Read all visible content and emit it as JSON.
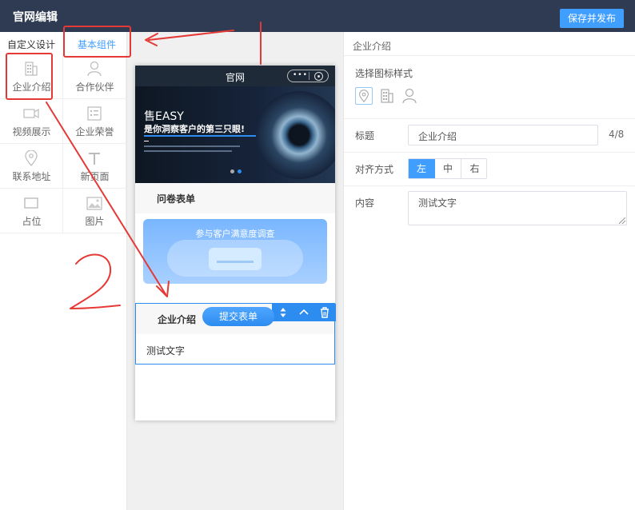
{
  "header": {
    "title": "官网编辑",
    "publish_label": "保存并发布"
  },
  "sidebar": {
    "tabs": [
      {
        "label": "自定义设计"
      },
      {
        "label": "基本组件"
      }
    ],
    "components": [
      {
        "label": "企业介绍",
        "icon": "building-icon"
      },
      {
        "label": "合作伙伴",
        "icon": "user-icon"
      },
      {
        "label": "视频展示",
        "icon": "video-icon"
      },
      {
        "label": "企业荣誉",
        "icon": "list-icon"
      },
      {
        "label": "联系地址",
        "icon": "map-pin-icon"
      },
      {
        "label": "新页面",
        "icon": "text-icon"
      },
      {
        "label": "占位",
        "icon": "placeholder-icon"
      },
      {
        "label": "图片",
        "icon": "image-icon"
      }
    ]
  },
  "preview": {
    "app_title": "官网",
    "capsule_dots": "•••",
    "banner_line1": "售EASY",
    "banner_line2": "是你洞察客户的第三只眼!",
    "survey_section_title": "问卷表单",
    "survey_card_title": "参与客户满意度调查",
    "survey_submit": "提交表单",
    "selected_section_title": "企业介绍",
    "selected_section_text": "测试文字"
  },
  "panel": {
    "breadcrumb": "企业介绍",
    "icon_style_label": "选择图标样式",
    "title_label": "标题",
    "title_value": "企业介绍",
    "title_counter": "4/8",
    "align_label": "对齐方式",
    "align_options": [
      "左",
      "中",
      "右"
    ],
    "align_selected": "左",
    "content_label": "内容",
    "content_value": "测试文字"
  },
  "annotation": {
    "handwritten_number": "2",
    "color": "#e53935"
  },
  "colors": {
    "header_bg": "#2f3b52",
    "accent": "#409eff",
    "canvas_bg": "#f0f0f0"
  }
}
